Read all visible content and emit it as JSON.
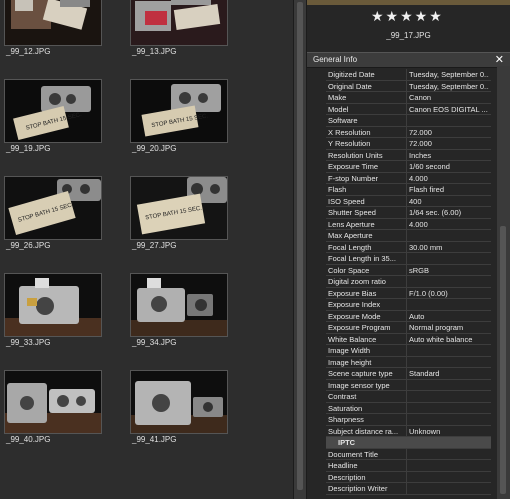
{
  "thumbnails": [
    {
      "name": "_99_12.JPG"
    },
    {
      "name": "_99_13.JPG"
    },
    {
      "name": "_99_19.JPG"
    },
    {
      "name": "_99_20.JPG"
    },
    {
      "name": "_99_26.JPG"
    },
    {
      "name": "_99_27.JPG"
    },
    {
      "name": "_99_33.JPG"
    },
    {
      "name": "_99_34.JPG"
    },
    {
      "name": "_99_40.JPG"
    },
    {
      "name": "_99_41.JPG"
    }
  ],
  "preview": {
    "rating_stars": "★★★★★",
    "filename": "_99_17.JPG"
  },
  "general_info": {
    "title": "General Info",
    "close_glyph": "✕",
    "rows": [
      {
        "key": "Digitized Date",
        "value": "Tuesday, September 0..."
      },
      {
        "key": "Original Date",
        "value": "Tuesday, September 0..."
      },
      {
        "key": "Make",
        "value": "Canon"
      },
      {
        "key": "Model",
        "value": "Canon EOS DIGITAL ..."
      },
      {
        "key": "Software",
        "value": ""
      },
      {
        "key": "X Resolution",
        "value": "72.000"
      },
      {
        "key": "Y Resolution",
        "value": "72.000"
      },
      {
        "key": "Resolution Units",
        "value": "Inches"
      },
      {
        "key": "Exposure Time",
        "value": "1/60 second"
      },
      {
        "key": "F-stop Number",
        "value": "4.000"
      },
      {
        "key": "Flash",
        "value": "Flash fired"
      },
      {
        "key": "ISO Speed",
        "value": "400"
      },
      {
        "key": "Shutter Speed",
        "value": "1/64 sec. (6.00)"
      },
      {
        "key": "Lens Aperture",
        "value": "4.000"
      },
      {
        "key": "Max Aperture",
        "value": ""
      },
      {
        "key": "Focal Length",
        "value": "30.00 mm"
      },
      {
        "key": "Focal Length in 35...",
        "value": ""
      },
      {
        "key": "Color Space",
        "value": "sRGB"
      },
      {
        "key": "Digital zoom ratio",
        "value": ""
      },
      {
        "key": "Exposure Bias",
        "value": "F/1.0 (0.00)"
      },
      {
        "key": "Exposure Index",
        "value": ""
      },
      {
        "key": "Exposure Mode",
        "value": "Auto"
      },
      {
        "key": "Exposure Program",
        "value": "Normal program"
      },
      {
        "key": "White Balance",
        "value": "Auto white balance"
      },
      {
        "key": "Image Width",
        "value": ""
      },
      {
        "key": "Image height",
        "value": ""
      },
      {
        "key": "Scene capture type",
        "value": "Standard"
      },
      {
        "key": "Image sensor type",
        "value": ""
      },
      {
        "key": "Contrast",
        "value": ""
      },
      {
        "key": "Saturation",
        "value": ""
      },
      {
        "key": "Sharpness",
        "value": ""
      },
      {
        "key": "Subject distance ra...",
        "value": "Unknown"
      },
      {
        "key": "IPTC",
        "value": "",
        "section": true
      },
      {
        "key": "Document Title",
        "value": ""
      },
      {
        "key": "Headline",
        "value": ""
      },
      {
        "key": "Description",
        "value": ""
      },
      {
        "key": "Description Writer",
        "value": ""
      }
    ]
  }
}
